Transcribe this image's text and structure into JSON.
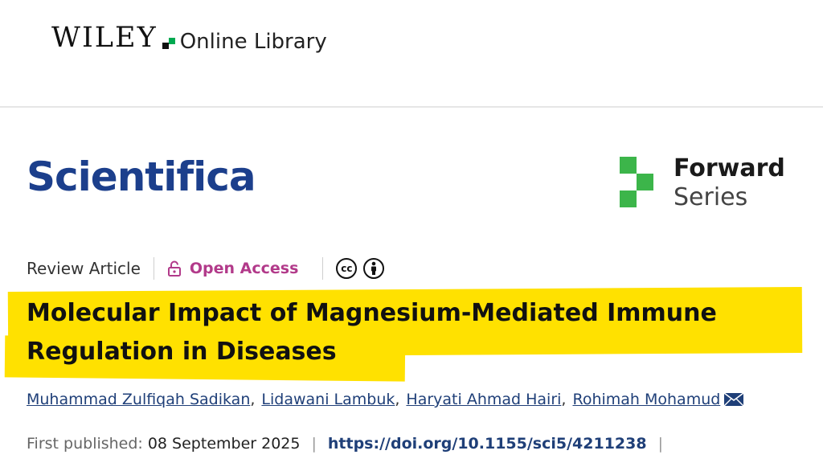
{
  "header": {
    "publisher_wordmark": "WILEY",
    "library_label": "Online Library"
  },
  "journal": {
    "name": "Scientifica",
    "series_line1": "Forward",
    "series_line2": "Series"
  },
  "article_meta": {
    "type": "Review Article",
    "access_label": "Open Access",
    "license_icons": [
      "cc-icon",
      "by-icon"
    ]
  },
  "article": {
    "title_line1": "Molecular Impact of Magnesium-Mediated Immune",
    "title_line2": "Regulation in Diseases",
    "authors": [
      "Muhammad Zulfiqah Sadikan",
      "Lidawani Lambuk",
      "Haryati Ahmad Hairi",
      "Rohimah Mohamud"
    ],
    "separator": ",",
    "first_published_label": "First published:",
    "first_published_date": "08 September 2025",
    "doi_link": "https://doi.org/10.1155/sci5/4211238",
    "pipe": "|"
  },
  "colors": {
    "journal_blue": "#1c3f8c",
    "open_access": "#b23a8a",
    "highlight": "#ffe100",
    "wiley_green": "#00a950",
    "series_green": "#3cb54a",
    "link_blue": "#1f3f78"
  }
}
